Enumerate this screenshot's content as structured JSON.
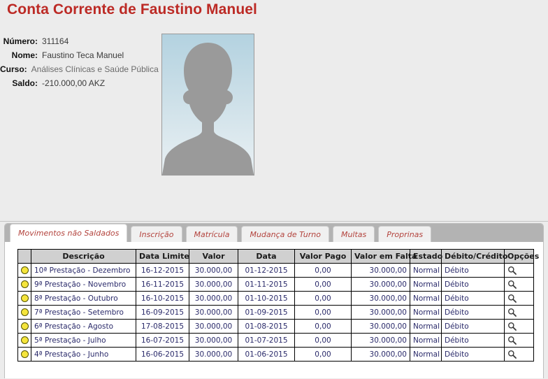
{
  "page": {
    "title": "Conta Corrente de Faustino Manuel",
    "title_color": "#bc2a25",
    "background_color": "#ececec"
  },
  "info": {
    "rows": [
      {
        "label": "Número:",
        "value": "311164"
      },
      {
        "label": "Nome:",
        "value": "Faustino Teca Manuel"
      },
      {
        "label": "Curso:",
        "value": "Análises Clínicas e Saúde Pública"
      },
      {
        "label": "Saldo:",
        "value": "-210.000,00 AKZ"
      }
    ]
  },
  "photo": {
    "icon": "user-silhouette-placeholder"
  },
  "tabs": [
    {
      "label": "Movimentos não Saldados",
      "active": true
    },
    {
      "label": "Inscrição",
      "active": false
    },
    {
      "label": "Matrícula",
      "active": false
    },
    {
      "label": "Mudança de Turno",
      "active": false
    },
    {
      "label": "Multas",
      "active": false
    },
    {
      "label": "Proprinas",
      "active": false
    }
  ],
  "table": {
    "headers": [
      "",
      "Descrição",
      "Data Limite",
      "Valor",
      "Data",
      "Valor Pago",
      "Valor em Falta",
      "Estado",
      "Débito/Crédito",
      "Opções"
    ],
    "status_icon": "yellow-circle-icon",
    "options_icon": "magnifier-icon",
    "rows": [
      {
        "status": "pending",
        "descricao": "10ª Prestação - Dezembro",
        "data_limite": "16-12-2015",
        "valor": "30.000,00",
        "data": "01-12-2015",
        "valor_pago": "0,00",
        "valor_em_falta": "30.000,00",
        "estado": "Normal",
        "debito_credito": "Débito"
      },
      {
        "status": "pending",
        "descricao": "9ª Prestação - Novembro",
        "data_limite": "16-11-2015",
        "valor": "30.000,00",
        "data": "01-11-2015",
        "valor_pago": "0,00",
        "valor_em_falta": "30.000,00",
        "estado": "Normal",
        "debito_credito": "Débito"
      },
      {
        "status": "pending",
        "descricao": "8ª Prestação - Outubro",
        "data_limite": "16-10-2015",
        "valor": "30.000,00",
        "data": "01-10-2015",
        "valor_pago": "0,00",
        "valor_em_falta": "30.000,00",
        "estado": "Normal",
        "debito_credito": "Débito"
      },
      {
        "status": "pending",
        "descricao": "7ª Prestação - Setembro",
        "data_limite": "16-09-2015",
        "valor": "30.000,00",
        "data": "01-09-2015",
        "valor_pago": "0,00",
        "valor_em_falta": "30.000,00",
        "estado": "Normal",
        "debito_credito": "Débito"
      },
      {
        "status": "pending",
        "descricao": "6ª Prestação - Agosto",
        "data_limite": "17-08-2015",
        "valor": "30.000,00",
        "data": "01-08-2015",
        "valor_pago": "0,00",
        "valor_em_falta": "30.000,00",
        "estado": "Normal",
        "debito_credito": "Débito"
      },
      {
        "status": "pending",
        "descricao": "5ª Prestação - Julho",
        "data_limite": "16-07-2015",
        "valor": "30.000,00",
        "data": "01-07-2015",
        "valor_pago": "0,00",
        "valor_em_falta": "30.000,00",
        "estado": "Normal",
        "debito_credito": "Débito"
      },
      {
        "status": "pending",
        "descricao": "4ª Prestação - Junho",
        "data_limite": "16-06-2015",
        "valor": "30.000,00",
        "data": "01-06-2015",
        "valor_pago": "0,00",
        "valor_em_falta": "30.000,00",
        "estado": "Normal",
        "debito_credito": "Débito"
      }
    ]
  }
}
